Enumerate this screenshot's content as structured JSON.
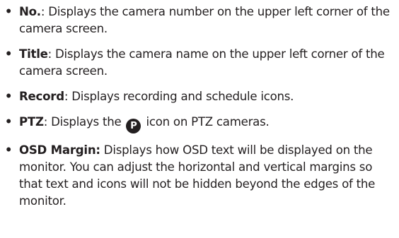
{
  "items": [
    {
      "bullet": "•",
      "term": "No.",
      "sep": ":",
      "text": " Displays the camera number on the upper left corner of the camera screen."
    },
    {
      "bullet": "•",
      "term": "Title",
      "sep": ":",
      "text": " Displays the camera name on the upper left corner of the camera screen."
    },
    {
      "bullet": "•",
      "term": "Record",
      "sep": ":",
      "text": " Displays recording and schedule icons."
    },
    {
      "bullet": "•",
      "term": "PTZ",
      "sep": ":",
      "text_before": " Displays the ",
      "icon_glyph": "P",
      "icon_name": "ptz-icon",
      "text_after": " icon on PTZ cameras."
    },
    {
      "bullet": "•",
      "term": "OSD Margin:",
      "text": " Displays how OSD text will be displayed on the monitor. You can adjust the horizontal and vertical margins so that text and icons will not be hidden beyond the edges of the monitor."
    }
  ]
}
